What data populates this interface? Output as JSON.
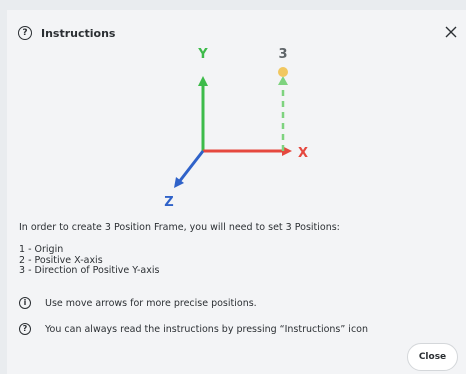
{
  "dialog": {
    "title": "Instructions",
    "title_icon": "question-circle-icon",
    "close_icon": "close-icon",
    "close_button_label": "Close"
  },
  "diagram": {
    "axis_y_label": "Y",
    "axis_x_label": "X",
    "axis_z_label": "Z",
    "point_label": "3",
    "colors": {
      "y_axis": "#3dbb4a",
      "x_axis": "#e5483f",
      "z_axis": "#2f62c9",
      "point": "#f1c760",
      "dashed": "#7ed37f"
    }
  },
  "content": {
    "intro": "In order to create 3 Position Frame, you will need to set 3 Positions:",
    "steps": [
      "1 - Origin",
      "2 - Positive X-axis",
      "3 - Direction of Positive Y-axis"
    ],
    "note1_icon": "info-circle-icon",
    "note1": "Use move arrows for more precise positions.",
    "note2_icon": "question-circle-icon",
    "note2": "You can always read the instructions by pressing “Instructions” icon"
  }
}
